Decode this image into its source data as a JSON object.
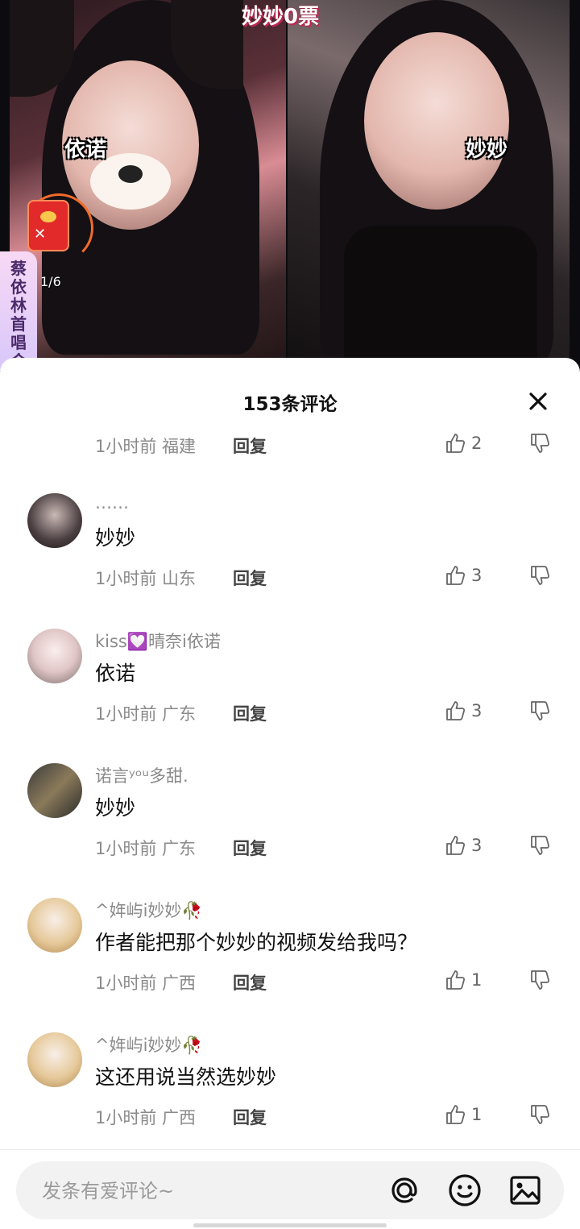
{
  "video": {
    "title": "妙妙0票",
    "left_label": "依诺",
    "right_label": "妙妙",
    "red_packet_count": "1/6",
    "concert_tab": "蔡依林首唱会"
  },
  "comments_panel": {
    "title": "153条评论",
    "close_icon": "close-icon",
    "first_meta": {
      "time": "1小时前 福建",
      "reply": "回复",
      "likes": "2"
    },
    "comments": [
      {
        "user": "……",
        "text": "妙妙",
        "time": "1小时前 山东",
        "reply": "回复",
        "likes": "3"
      },
      {
        "user": "kiss💟晴奈i依诺",
        "text": "依诺",
        "time": "1小时前 广东",
        "reply": "回复",
        "likes": "3"
      },
      {
        "user": "诺言ʸᵒᵘ多甜.",
        "text": "妙妙",
        "time": "1小时前 广东",
        "reply": "回复",
        "likes": "3"
      },
      {
        "user": "^姩屿i妙妙🥀",
        "text": "作者能把那个妙妙的视频发给我吗？",
        "time": "1小时前 广西",
        "reply": "回复",
        "likes": "1"
      },
      {
        "user": "^姩屿i妙妙🥀",
        "text": "这还用说当然选妙妙",
        "time": "1小时前 广西",
        "reply": "回复",
        "likes": "1"
      }
    ]
  },
  "input": {
    "placeholder": "发条有爱评论~",
    "icons": [
      "at-icon",
      "emoji-icon",
      "image-icon"
    ]
  }
}
